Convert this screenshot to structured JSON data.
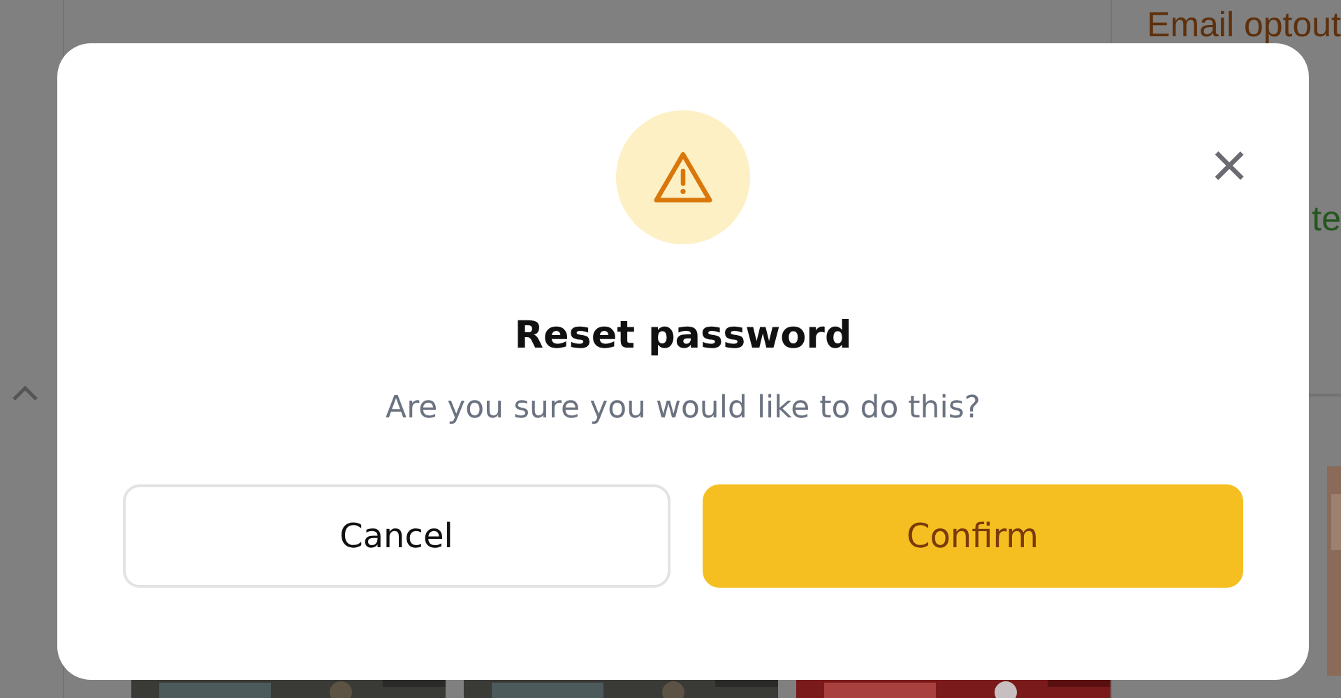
{
  "background": {
    "field_label": "Email optout",
    "partial_text": "te"
  },
  "dialog": {
    "title": "Reset password",
    "message": "Are you sure you would like to do this?",
    "close": "×",
    "buttons": [
      {
        "label": "Cancel",
        "kind": "secondary"
      },
      {
        "label": "Confirm",
        "kind": "primary"
      }
    ]
  }
}
